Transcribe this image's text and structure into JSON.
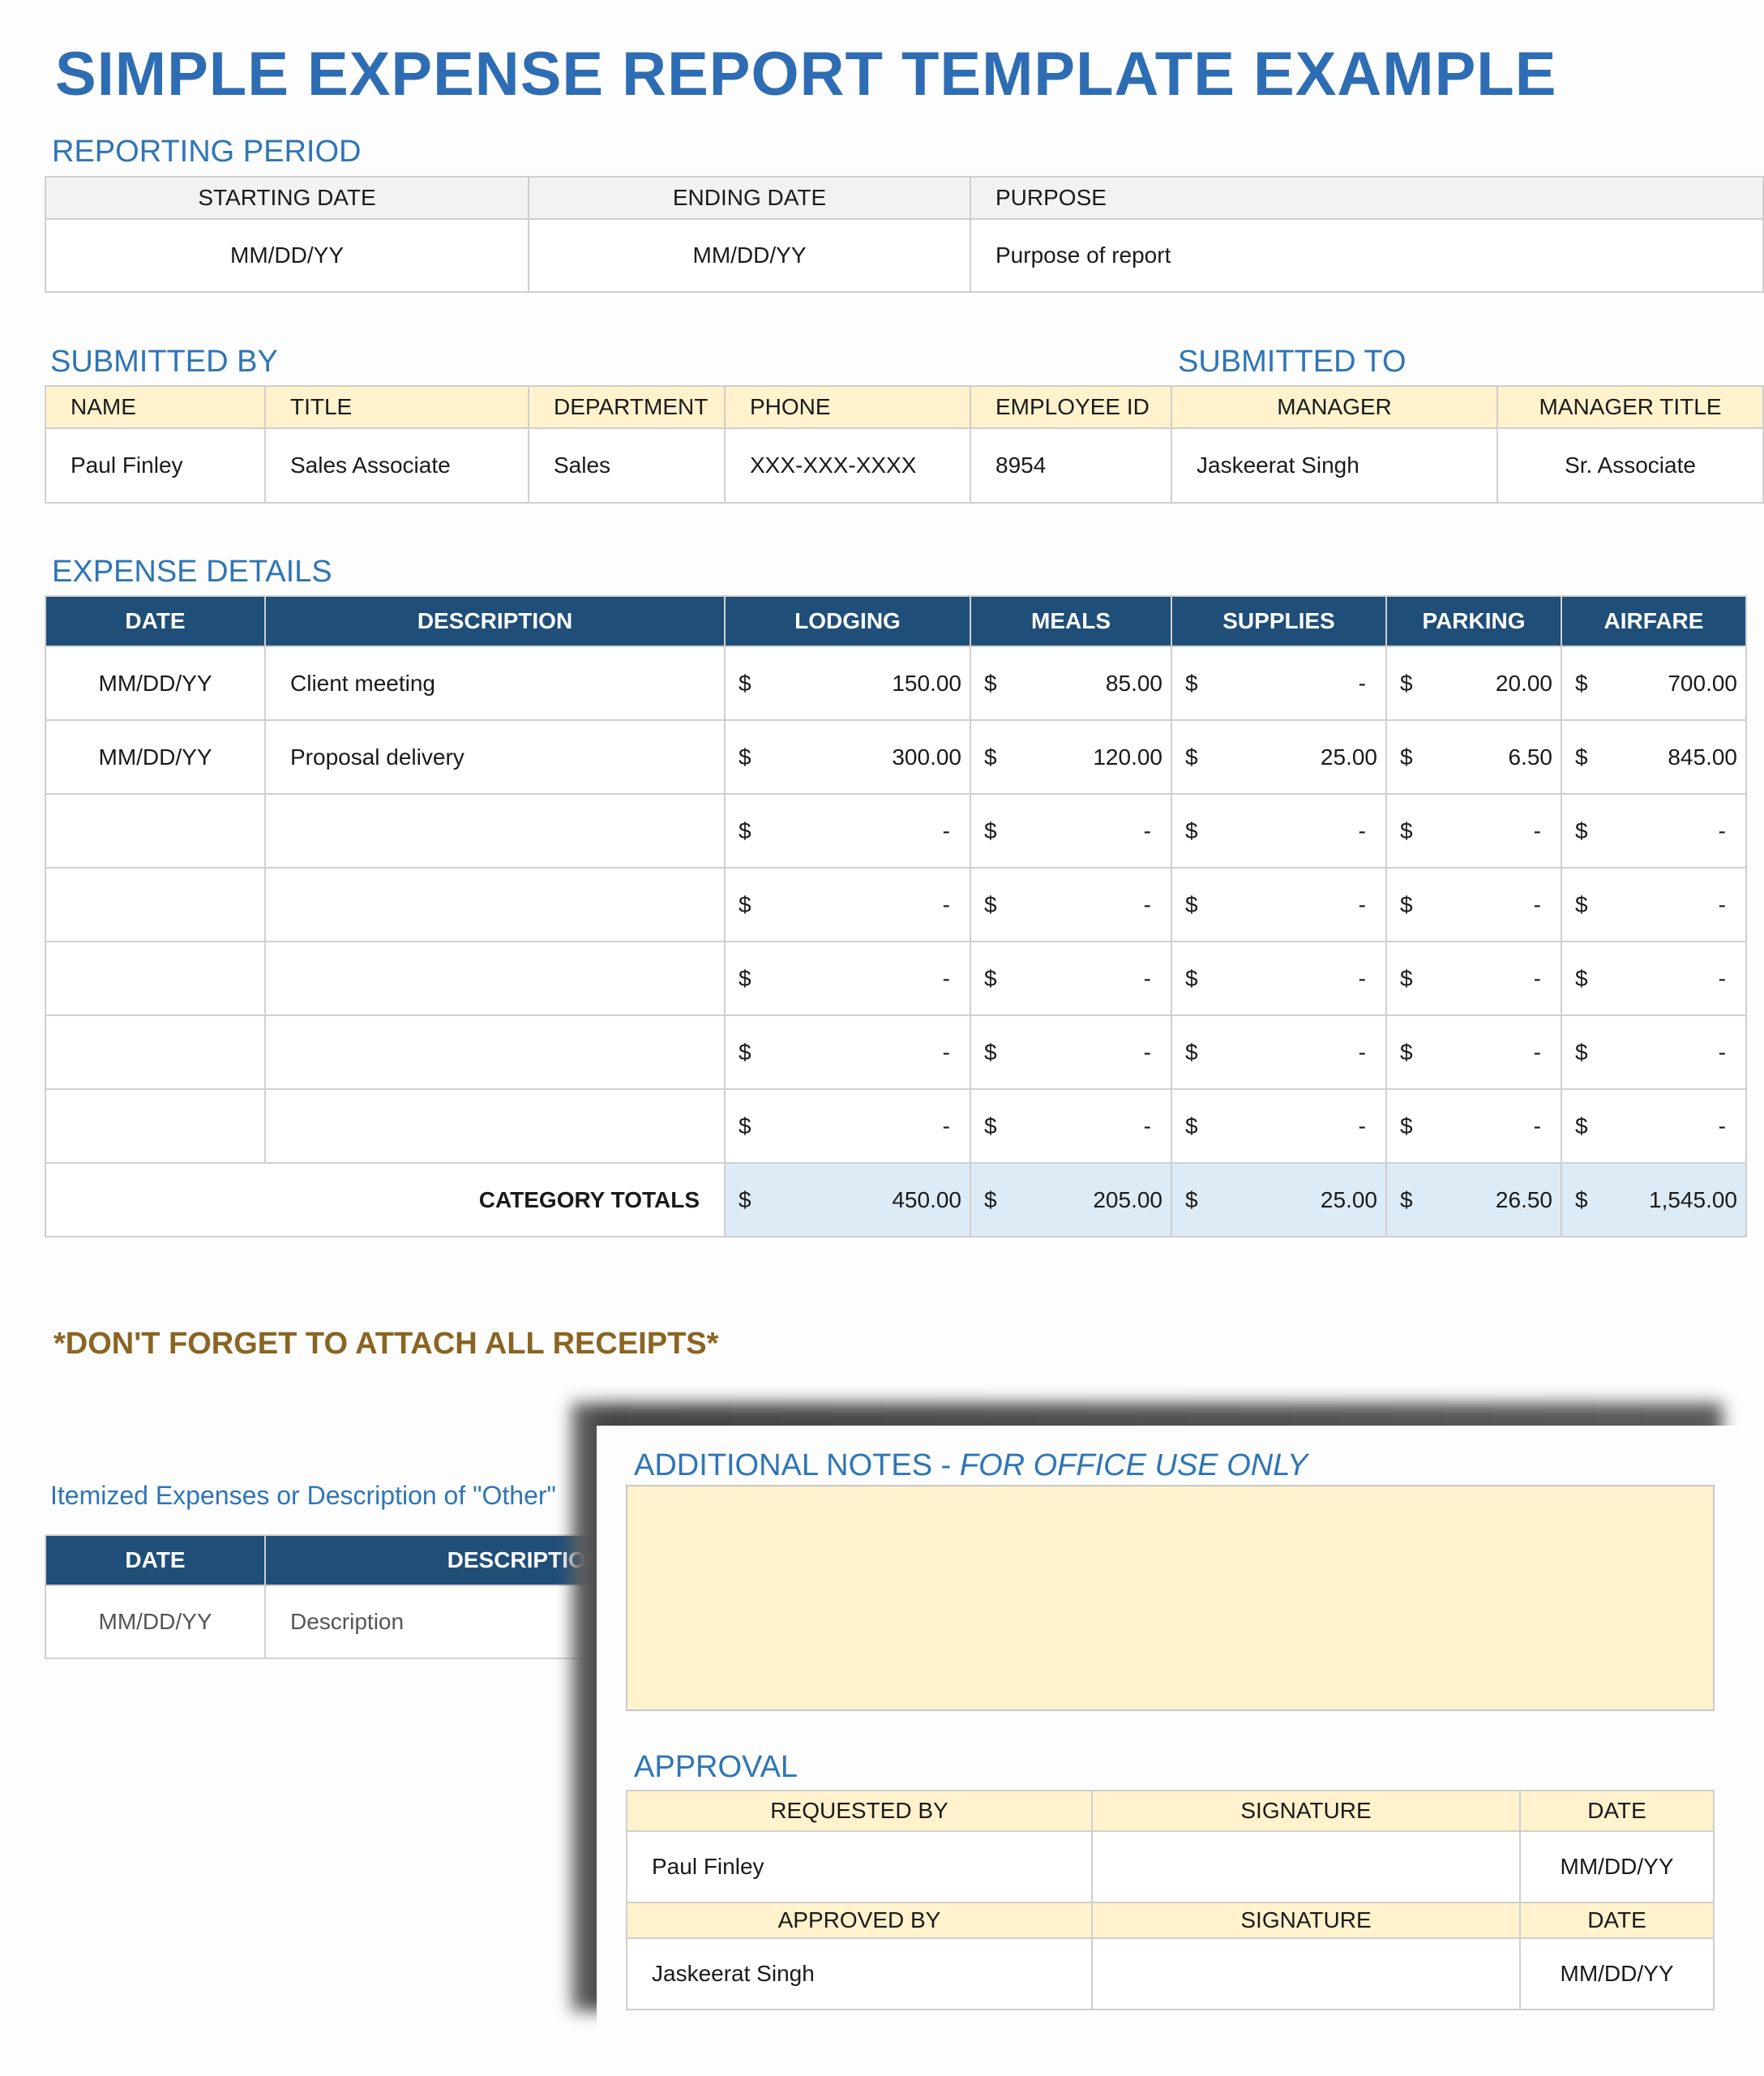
{
  "title": "SIMPLE EXPENSE REPORT TEMPLATE EXAMPLE",
  "reporting_period": {
    "label": "REPORTING PERIOD",
    "headers": [
      "STARTING DATE",
      "ENDING DATE",
      "PURPOSE"
    ],
    "values": [
      "MM/DD/YY",
      "MM/DD/YY",
      "Purpose of report"
    ]
  },
  "submitted_by": {
    "label": "SUBMITTED BY"
  },
  "submitted_to": {
    "label": "SUBMITTED TO"
  },
  "submitter_table": {
    "headers": [
      "NAME",
      "TITLE",
      "DEPARTMENT",
      "PHONE",
      "EMPLOYEE ID",
      "MANAGER",
      "MANAGER TITLE"
    ],
    "values": [
      "Paul Finley",
      "Sales Associate",
      "Sales",
      "XXX-XXX-XXXX",
      "8954",
      "Jaskeerat Singh",
      "Sr. Associate"
    ]
  },
  "expense_details": {
    "label": "EXPENSE DETAILS",
    "headers": [
      "DATE",
      "DESCRIPTION",
      "LODGING",
      "MEALS",
      "SUPPLIES",
      "PARKING",
      "AIRFARE"
    ],
    "currency": "$",
    "rows": [
      {
        "date": "MM/DD/YY",
        "description": "Client meeting",
        "amounts": [
          "150.00",
          "85.00",
          "-",
          "20.00",
          "700.00"
        ]
      },
      {
        "date": "MM/DD/YY",
        "description": "Proposal delivery",
        "amounts": [
          "300.00",
          "120.00",
          "25.00",
          "6.50",
          "845.00"
        ]
      },
      {
        "date": "",
        "description": "",
        "amounts": [
          "-",
          "-",
          "-",
          "-",
          "-"
        ]
      },
      {
        "date": "",
        "description": "",
        "amounts": [
          "-",
          "-",
          "-",
          "-",
          "-"
        ]
      },
      {
        "date": "",
        "description": "",
        "amounts": [
          "-",
          "-",
          "-",
          "-",
          "-"
        ]
      },
      {
        "date": "",
        "description": "",
        "amounts": [
          "-",
          "-",
          "-",
          "-",
          "-"
        ]
      },
      {
        "date": "",
        "description": "",
        "amounts": [
          "-",
          "-",
          "-",
          "-",
          "-"
        ]
      }
    ],
    "totals_label": "CATEGORY TOTALS",
    "totals": [
      "450.00",
      "205.00",
      "25.00",
      "26.50",
      "1,545.00"
    ]
  },
  "receipts_note": "*DON'T FORGET TO ATTACH ALL RECEIPTS*",
  "itemized": {
    "label": "Itemized Expenses or Description of \"Other\"",
    "headers": [
      "DATE",
      "DESCRIPTION"
    ],
    "values": [
      "MM/DD/YY",
      "Description"
    ]
  },
  "notes": {
    "label": "ADDITIONAL NOTES - ",
    "label_italic": "FOR OFFICE USE ONLY",
    "value": ""
  },
  "approval": {
    "label": "APPROVAL",
    "requested_headers": [
      "REQUESTED BY",
      "SIGNATURE",
      "DATE"
    ],
    "requested_values": [
      "Paul Finley",
      "",
      "MM/DD/YY"
    ],
    "approved_headers": [
      "APPROVED BY",
      "SIGNATURE",
      "DATE"
    ],
    "approved_values": [
      "Jaskeerat Singh",
      "",
      "MM/DD/YY"
    ]
  },
  "colors": {
    "title": "#2e6db4",
    "header_navy": "#1f4e79",
    "header_yellow": "#fff2cc",
    "totals_blue": "#ddebf7",
    "note_brown": "#8a6422"
  }
}
